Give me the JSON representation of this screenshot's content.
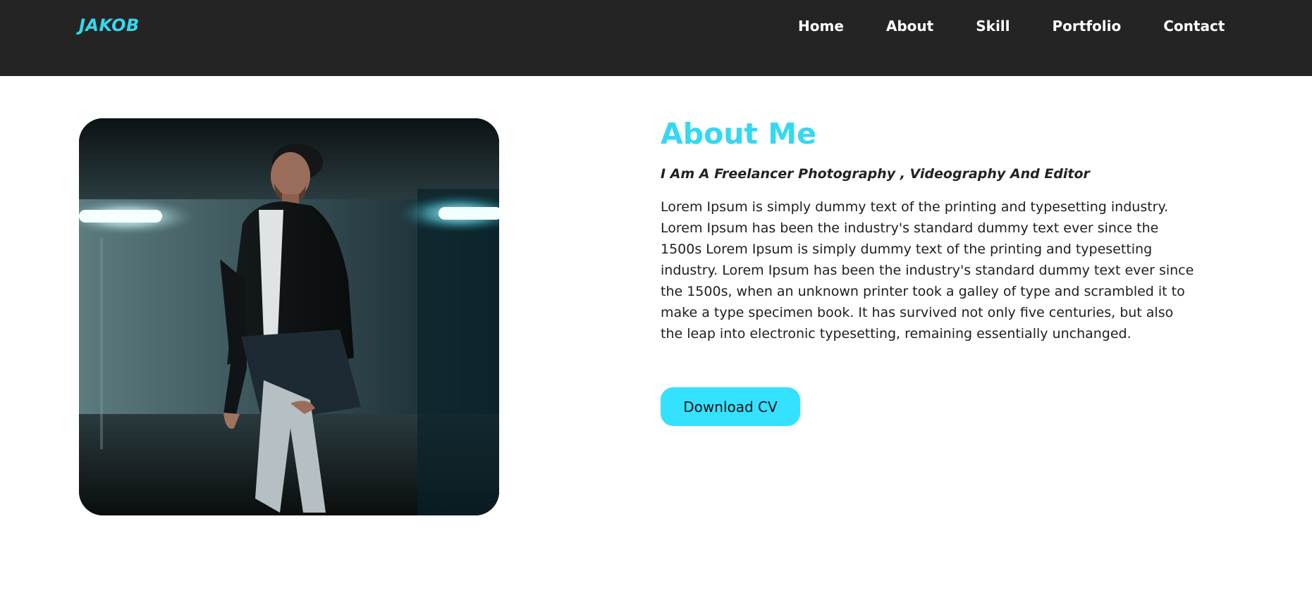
{
  "header": {
    "logo": "JAKOB",
    "nav": [
      {
        "label": "Home"
      },
      {
        "label": "About"
      },
      {
        "label": "Skill"
      },
      {
        "label": "Portfolio"
      },
      {
        "label": "Contact"
      }
    ]
  },
  "about": {
    "title": "About Me",
    "subtitle": "I Am A Freelancer Photography , Videography And Editor",
    "body_lines": [
      "Lorem Ipsum is simply dummy text of the printing and typesetting industry.",
      "Lorem Ipsum has been the industry's standard dummy text ever since the",
      "1500s Lorem Ipsum is simply dummy text of the printing and typesetting",
      "industry. Lorem Ipsum has been the industry's standard dummy text ever since",
      "the 1500s, when an unknown printer took a galley of type and scrambled it to",
      "make a type specimen book. It has survived not only five centuries, but also",
      "the leap into electronic typesetting, remaining essentially unchanged."
    ],
    "button_label": "Download CV"
  },
  "colors": {
    "accent": "#34d8f0",
    "button": "#34e1ff",
    "navbar": "#252425",
    "text": "#1e1e1e"
  }
}
